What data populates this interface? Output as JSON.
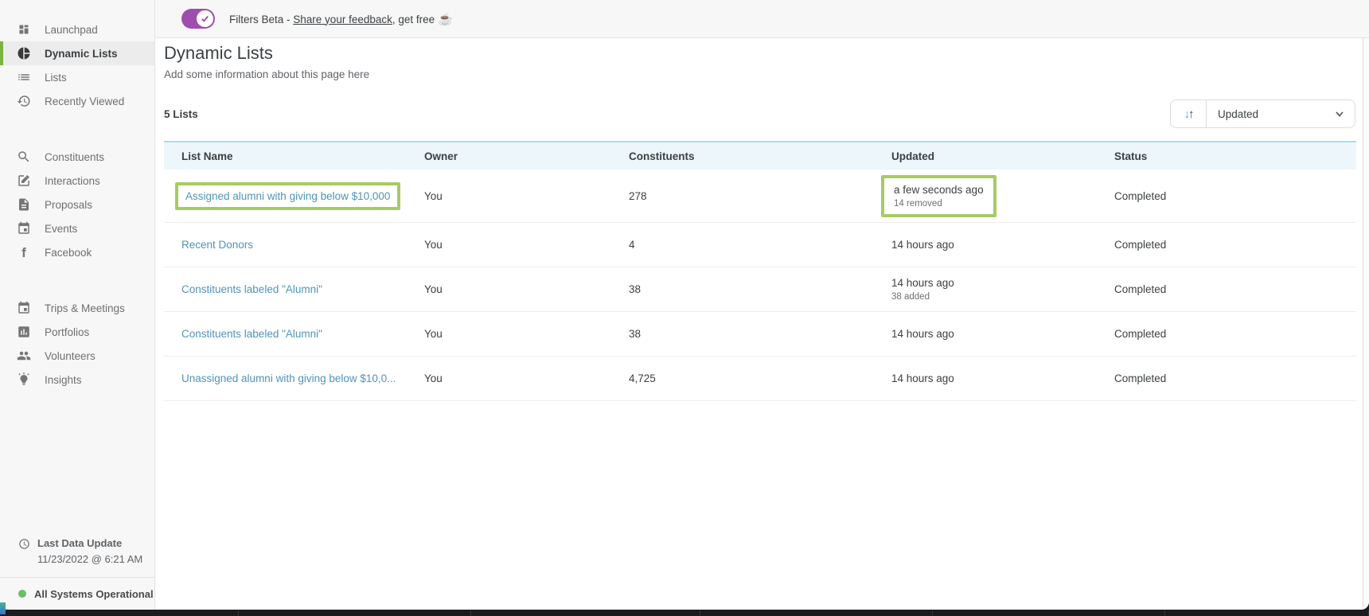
{
  "banner": {
    "prefix": "Filters Beta - ",
    "link_label": "Share your feedback",
    "suffix": ", get free",
    "emoji": "☕",
    "toggle_on": true
  },
  "sidebar": {
    "groups": [
      {
        "items": [
          {
            "label": "Launchpad",
            "icon": "launchpad-icon",
            "active": false
          },
          {
            "label": "Dynamic Lists",
            "icon": "pie-chart-icon",
            "active": true
          },
          {
            "label": "Lists",
            "icon": "list-icon",
            "active": false
          },
          {
            "label": "Recently Viewed",
            "icon": "history-icon",
            "active": false
          }
        ]
      },
      {
        "items": [
          {
            "label": "Constituents",
            "icon": "search-icon",
            "active": false
          },
          {
            "label": "Interactions",
            "icon": "edit-icon",
            "active": false
          },
          {
            "label": "Proposals",
            "icon": "document-icon",
            "active": false
          },
          {
            "label": "Events",
            "icon": "calendar-icon",
            "active": false
          },
          {
            "label": "Facebook",
            "icon": "facebook-icon",
            "active": false
          }
        ]
      },
      {
        "items": [
          {
            "label": "Trips & Meetings",
            "icon": "calendar-icon",
            "active": false
          },
          {
            "label": "Portfolios",
            "icon": "bar-chart-icon",
            "active": false
          },
          {
            "label": "Volunteers",
            "icon": "people-icon",
            "active": false
          },
          {
            "label": "Insights",
            "icon": "idea-icon",
            "active": false
          }
        ]
      }
    ],
    "footer": {
      "last_update_label": "Last Data Update",
      "last_update_value": "11/23/2022 @ 6:21 AM",
      "status": "All Systems Operational"
    }
  },
  "page": {
    "title": "Dynamic Lists",
    "subtitle": "Add some information about this page here",
    "count_label": "5 Lists",
    "sort_label": "Updated"
  },
  "table": {
    "columns": [
      "List Name",
      "Owner",
      "Constituents",
      "Updated",
      "Status"
    ],
    "rows": [
      {
        "name": "Assigned alumni with giving below $10,000",
        "owner": "You",
        "constituents": "278",
        "updated": "a few seconds ago",
        "updated_detail": "14 removed",
        "status": "Completed",
        "highlighted": true
      },
      {
        "name": "Recent Donors",
        "owner": "You",
        "constituents": "4",
        "updated": "14 hours ago",
        "updated_detail": "",
        "status": "Completed",
        "highlighted": false
      },
      {
        "name": "Constituents labeled \"Alumni\"",
        "owner": "You",
        "constituents": "38",
        "updated": "14 hours ago",
        "updated_detail": "38 added",
        "status": "Completed",
        "highlighted": false
      },
      {
        "name": "Constituents labeled \"Alumni\"",
        "owner": "You",
        "constituents": "38",
        "updated": "14 hours ago",
        "updated_detail": "",
        "status": "Completed",
        "highlighted": false
      },
      {
        "name": "Unassigned alumni with giving below $10,0...",
        "owner": "You",
        "constituents": "4,725",
        "updated": "14 hours ago",
        "updated_detail": "",
        "status": "Completed",
        "highlighted": false
      }
    ]
  },
  "colors": {
    "accent_purple": "#9e4fae",
    "highlight_green": "#a6cb66",
    "active_item_green": "#7cb342",
    "link_blue": "#4f94b8",
    "table_header_bg": "#edf6fb",
    "table_header_border": "#a9dbf2",
    "status_green": "#6abf69",
    "sort_down_arrow_blue": "#3fa7e1"
  }
}
